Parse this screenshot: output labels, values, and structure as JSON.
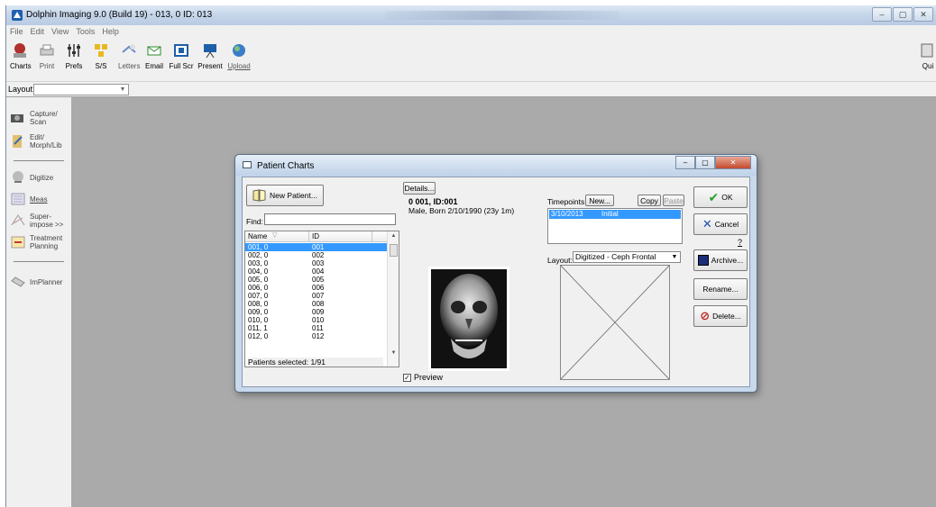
{
  "window": {
    "title": "Dolphin Imaging 9.0 (Build 19) - 013, 0  ID: 013",
    "controls": [
      "–",
      "▢",
      "✕"
    ]
  },
  "menu": [
    "File",
    "Edit",
    "View",
    "Tools",
    "Help"
  ],
  "toolbar": [
    {
      "label": "Charts",
      "icon": "charts-icon"
    },
    {
      "label": "Print",
      "icon": "printer-icon"
    },
    {
      "label": "Prefs",
      "icon": "sliders-icon"
    },
    {
      "label": "S/S",
      "icon": "ss-icon"
    },
    {
      "label": "Letters",
      "icon": "letters-icon"
    },
    {
      "label": "Email",
      "icon": "email-icon"
    },
    {
      "label": "Full Scr",
      "icon": "fullscreen-icon"
    },
    {
      "label": "Present",
      "icon": "present-icon"
    },
    {
      "label": "Upload",
      "icon": "upload-icon"
    }
  ],
  "toolbar_right": {
    "label": "Qui"
  },
  "layoutbar": {
    "label": "Layout:",
    "value": ""
  },
  "sidebar": [
    {
      "label": "Capture/ Scan",
      "icon": "camera-icon"
    },
    {
      "label": "Edit/ Morph/Lib",
      "icon": "edit-icon"
    },
    {
      "label": "Digitize",
      "icon": "digitize-icon"
    },
    {
      "label": "Meas",
      "icon": "measure-icon"
    },
    {
      "label": "Super- impose >>",
      "icon": "superimpose-icon"
    },
    {
      "label": "Treatment Planning",
      "icon": "treatment-icon"
    },
    {
      "label": "ImPlanner",
      "icon": "implanner-icon"
    }
  ],
  "dialog": {
    "title": "Patient Charts",
    "controls": [
      "–",
      "▢",
      "✕"
    ],
    "new_patient": "New Patient...",
    "details": "Details...",
    "find_label": "Find:",
    "find_value": "",
    "columns": {
      "name": "Name",
      "id": "ID"
    },
    "patients": [
      {
        "name": "001, 0",
        "id": "001"
      },
      {
        "name": "002, 0",
        "id": "002"
      },
      {
        "name": "003, 0",
        "id": "003"
      },
      {
        "name": "004, 0",
        "id": "004"
      },
      {
        "name": "005, 0",
        "id": "005"
      },
      {
        "name": "006, 0",
        "id": "006"
      },
      {
        "name": "007, 0",
        "id": "007"
      },
      {
        "name": "008, 0",
        "id": "008"
      },
      {
        "name": "009, 0",
        "id": "009"
      },
      {
        "name": "010, 0",
        "id": "010"
      },
      {
        "name": "011, 1",
        "id": "011"
      },
      {
        "name": "012, 0",
        "id": "012"
      }
    ],
    "status": "Patients selected: 1/91",
    "patient_id": "0 001, ID:001",
    "patient_info": "Male, Born 2/10/1990 (23y 1m)",
    "preview_label": "Preview",
    "preview_checked": true,
    "timepoints_label": "Timepoints:",
    "new_tp": "New...",
    "copy": "Copy",
    "paste": "Paste",
    "timepoints": [
      {
        "date": "3/10/2013",
        "label": "Initial"
      }
    ],
    "layout_label": "Layout:",
    "layout_value": "Digitized - Ceph Frontal",
    "ok": "OK",
    "cancel": "Cancel",
    "help": "?",
    "archive": "Archive...",
    "rename": "Rename...",
    "delete": "Delete..."
  }
}
